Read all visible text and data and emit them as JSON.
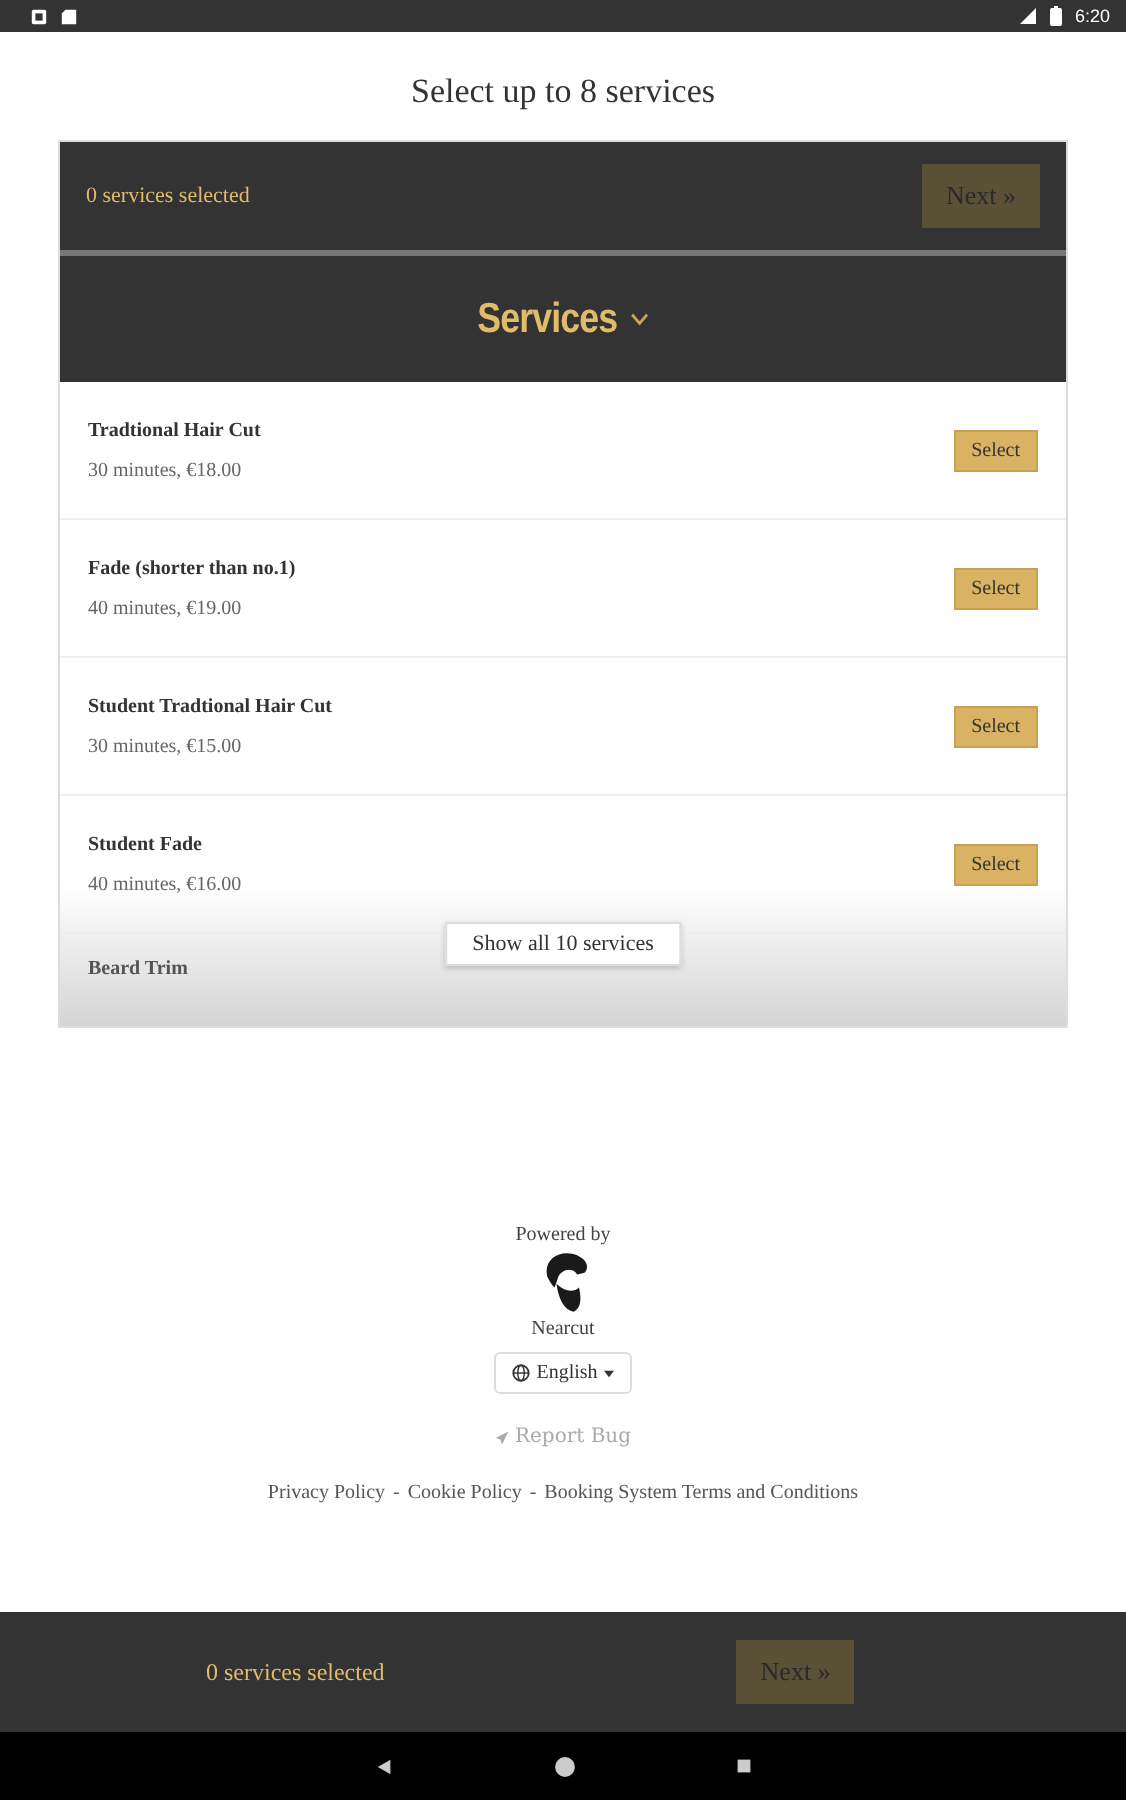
{
  "status_bar": {
    "time": "6:20"
  },
  "title": "Select up to 8 services",
  "top_bar": {
    "selected_count": "0 services selected",
    "next_button": {
      "label": "Next »",
      "disabled": true
    }
  },
  "section": {
    "title": "Services",
    "expanded": true
  },
  "services": [
    {
      "name": "Tradtional Hair Cut",
      "details": "30 minutes, €18.00",
      "button": "Select",
      "faded": false
    },
    {
      "name": "Fade (shorter than no.1)",
      "details": "40 minutes, €19.00",
      "button": "Select",
      "faded": false
    },
    {
      "name": "Student Tradtional Hair Cut",
      "details": "30 minutes, €15.00",
      "button": "Select",
      "faded": false
    },
    {
      "name": "Student Fade",
      "details": "40 minutes, €16.00",
      "button": "Select",
      "faded": false
    },
    {
      "name": "Beard Trim",
      "faded": true
    }
  ],
  "show_all_button": "Show all 10 services",
  "footer": {
    "powered_by": "Powered by",
    "brand": "Nearcut",
    "language": "English",
    "report_bug": "Report Bug",
    "links": [
      {
        "label": "Privacy Policy"
      },
      {
        "label": "Cookie Policy"
      },
      {
        "label": "Booking System Terms and Conditions"
      }
    ],
    "separator": "-"
  },
  "bottom_bar": {
    "selected_count": "0 services selected",
    "next_button": {
      "label": "Next »",
      "disabled": true
    }
  }
}
